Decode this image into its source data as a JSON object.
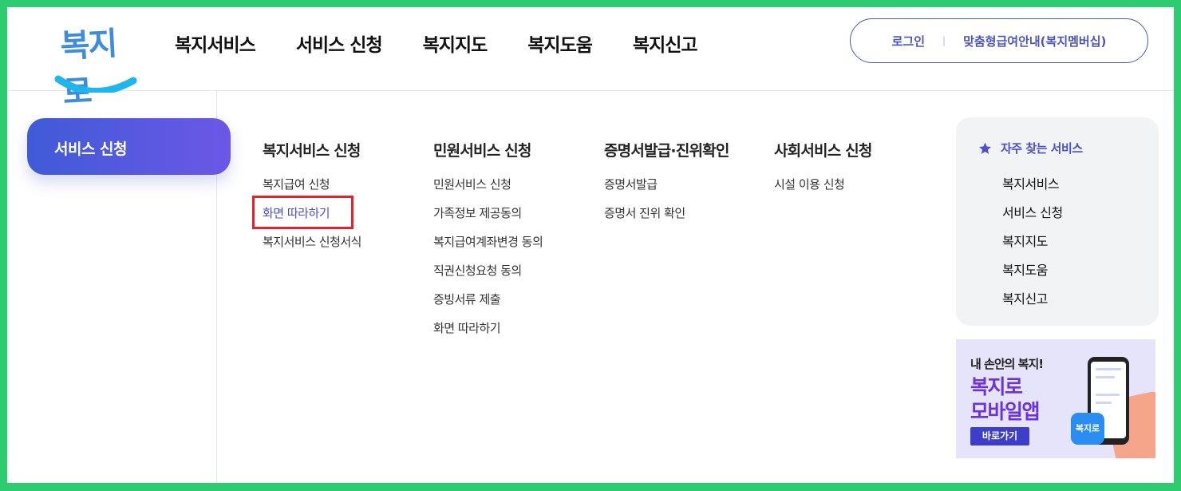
{
  "logo": {
    "text": "복지로",
    "name": "bokjiro-logo"
  },
  "gnb": [
    "복지서비스",
    "서비스 신청",
    "복지지도",
    "복지도움",
    "복지신고"
  ],
  "util": {
    "login": "로그인",
    "separator": "|",
    "membership": "맞춤형급여안내(복지멤버십)"
  },
  "sidebar": {
    "active_label": "서비스 신청"
  },
  "columns": [
    {
      "title": "복지서비스 신청",
      "links": [
        "복지급여 신청",
        "화면 따라하기",
        "복지서비스 신청서식"
      ]
    },
    {
      "title": "민원서비스 신청",
      "links": [
        "민원서비스 신청",
        "가족정보 제공동의",
        "복지급여계좌변경 동의",
        "직권신청요청 동의",
        "증빙서류 제출",
        "화면 따라하기"
      ]
    },
    {
      "title": "증명서발급·진위확인",
      "links": [
        "증명서발급",
        "증명서 진위 확인"
      ]
    },
    {
      "title": "사회서비스 신청",
      "links": [
        "시설 이용 신청"
      ]
    }
  ],
  "highlighted": {
    "column": 0,
    "link": 1
  },
  "favorites": {
    "title": "자주 찾는 서비스",
    "items": [
      "복지서비스",
      "서비스 신청",
      "복지지도",
      "복지도움",
      "복지신고"
    ]
  },
  "banner": {
    "subtitle": "내 손안의 복지!",
    "title_line1": "복지로",
    "title_line2": "모바일앱",
    "button": "바로가기",
    "app_icon_text": "복지로"
  },
  "colors": {
    "frame": "#2ecc71",
    "accent": "#4b4fd0",
    "highlight_border": "#e5222b"
  }
}
